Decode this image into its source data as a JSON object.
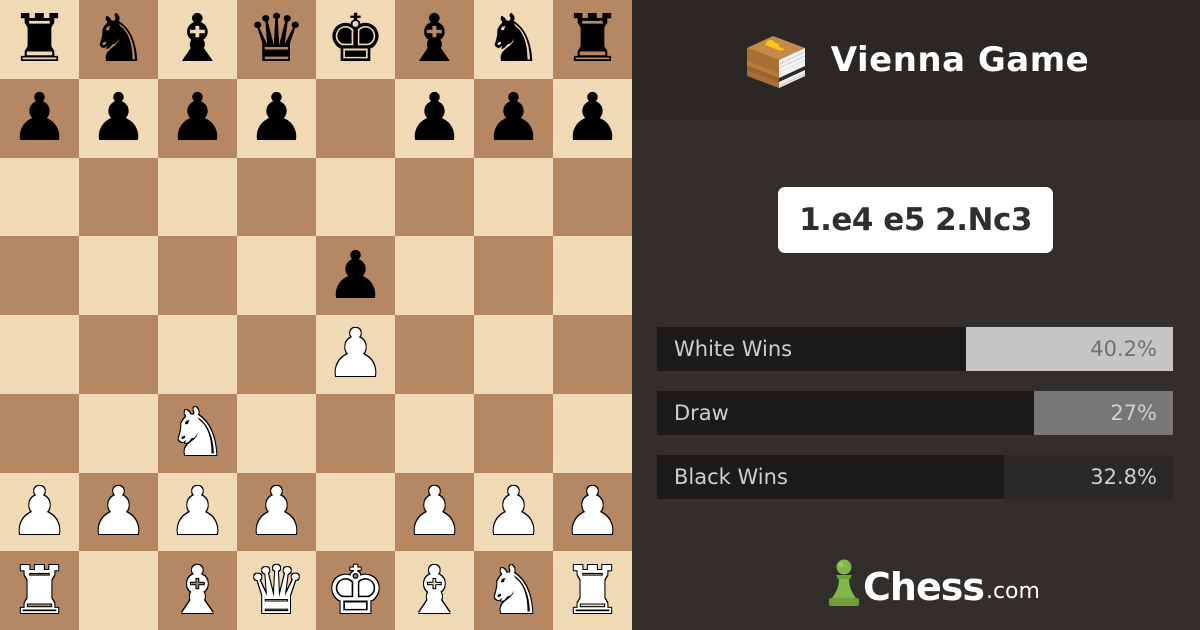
{
  "opening": {
    "name": "Vienna Game",
    "moves": "1.e4 e5 2.Nc3",
    "icon": "opening-book-icon"
  },
  "board": {
    "colors": {
      "light": "#f0d9b5",
      "dark": "#b58863"
    },
    "ranks": [
      [
        "bR",
        "bN",
        "bB",
        "bQ",
        "bK",
        "bB",
        "bN",
        "bR"
      ],
      [
        "bP",
        "bP",
        "bP",
        "bP",
        "",
        "bP",
        "bP",
        "bP"
      ],
      [
        "",
        "",
        "",
        "",
        "",
        "",
        "",
        ""
      ],
      [
        "",
        "",
        "",
        "",
        "bP",
        "",
        "",
        ""
      ],
      [
        "",
        "",
        "",
        "",
        "wP",
        "",
        "",
        ""
      ],
      [
        "",
        "",
        "wN",
        "",
        "",
        "",
        "",
        ""
      ],
      [
        "wP",
        "wP",
        "wP",
        "wP",
        "",
        "wP",
        "wP",
        "wP"
      ],
      [
        "wR",
        "",
        "wB",
        "wQ",
        "wK",
        "wB",
        "wN",
        "wR"
      ]
    ],
    "glyphs": {
      "K": "♚",
      "Q": "♛",
      "R": "♜",
      "B": "♝",
      "N": "♞",
      "P": "♟"
    }
  },
  "stats": [
    {
      "id": "white",
      "label": "White Wins",
      "value": "40.2%",
      "fraction": 0.402,
      "bar_color": "#c5c5c5",
      "text_color": "#707070"
    },
    {
      "id": "draw",
      "label": "Draw",
      "value": "27%",
      "fraction": 0.27,
      "bar_color": "#777777",
      "text_color": "#d0d0d0"
    },
    {
      "id": "black",
      "label": "Black Wins",
      "value": "32.8%",
      "fraction": 0.328,
      "bar_color": "#2b2927",
      "text_color": "#cfcfcf"
    }
  ],
  "brand": {
    "name": "Chess",
    "domain": ".com",
    "icon": "chess-pawn-logo-icon",
    "color": "#81b64c"
  }
}
